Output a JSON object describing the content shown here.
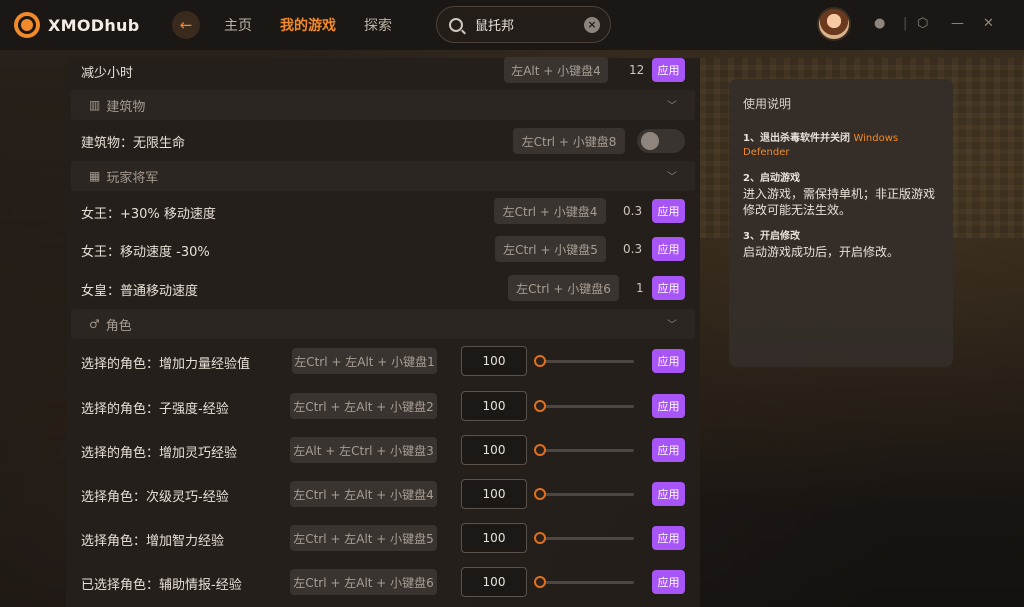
{
  "header": {
    "logo_text": "XMODhub",
    "nav": [
      "主页",
      "我的游戏",
      "探索"
    ],
    "search_value": "鼠托邦"
  },
  "colors": {
    "accent": "#f08a2a",
    "apply": "#a855f7"
  },
  "rows": {
    "r0": {
      "label": "减少小时",
      "hotkey": "左Alt + 小键盘4",
      "value": "12",
      "apply": "应用"
    },
    "s1": {
      "title": "建筑物"
    },
    "r1": {
      "label": "建筑物：无限生命",
      "hotkey": "左Ctrl + 小键盘8"
    },
    "s2": {
      "title": "玩家将军"
    },
    "r2": {
      "label": "女王：+30% 移动速度",
      "hotkey": "左Ctrl + 小键盘4",
      "value": "0.3",
      "apply": "应用"
    },
    "r3": {
      "label": "女王：移动速度 -30%",
      "hotkey": "左Ctrl + 小键盘5",
      "value": "0.3",
      "apply": "应用"
    },
    "r4": {
      "label": "女皇：普通移动速度",
      "hotkey": "左Ctrl + 小键盘6",
      "value": "1",
      "apply": "应用"
    },
    "s3": {
      "title": "角色"
    },
    "r5": {
      "label": "选择的角色：增加力量经验值",
      "hotkey": "左Ctrl + 左Alt + 小键盘1",
      "input": "100",
      "apply": "应用"
    },
    "r6": {
      "label": "选择的角色：子强度-经验",
      "hotkey": "左Ctrl + 左Alt + 小键盘2",
      "input": "100",
      "apply": "应用"
    },
    "r7": {
      "label": "选择的角色：增加灵巧经验",
      "hotkey": "左Alt + 左Ctrl + 小键盘3",
      "input": "100",
      "apply": "应用"
    },
    "r8": {
      "label": "选择角色：次级灵巧-经验",
      "hotkey": "左Ctrl + 左Alt + 小键盘4",
      "input": "100",
      "apply": "应用"
    },
    "r9": {
      "label": "选择角色：增加智力经验",
      "hotkey": "左Ctrl + 左Alt + 小键盘5",
      "input": "100",
      "apply": "应用"
    },
    "r10": {
      "label": "已选择角色：辅助情报-经验",
      "hotkey": "左Ctrl + 左Alt + 小键盘6",
      "input": "100",
      "apply": "应用"
    }
  },
  "side": {
    "title": "使用说明",
    "step1_title": "1、退出杀毒软件并关闭",
    "step1_warn": "Windows Defender",
    "step2_title": "2、启动游戏",
    "step2_body": "进入游戏，需保持单机；非正版游戏修改可能无法生效。",
    "step3_title": "3、开启修改",
    "step3_body": "启动游戏成功后，开启修改。"
  }
}
